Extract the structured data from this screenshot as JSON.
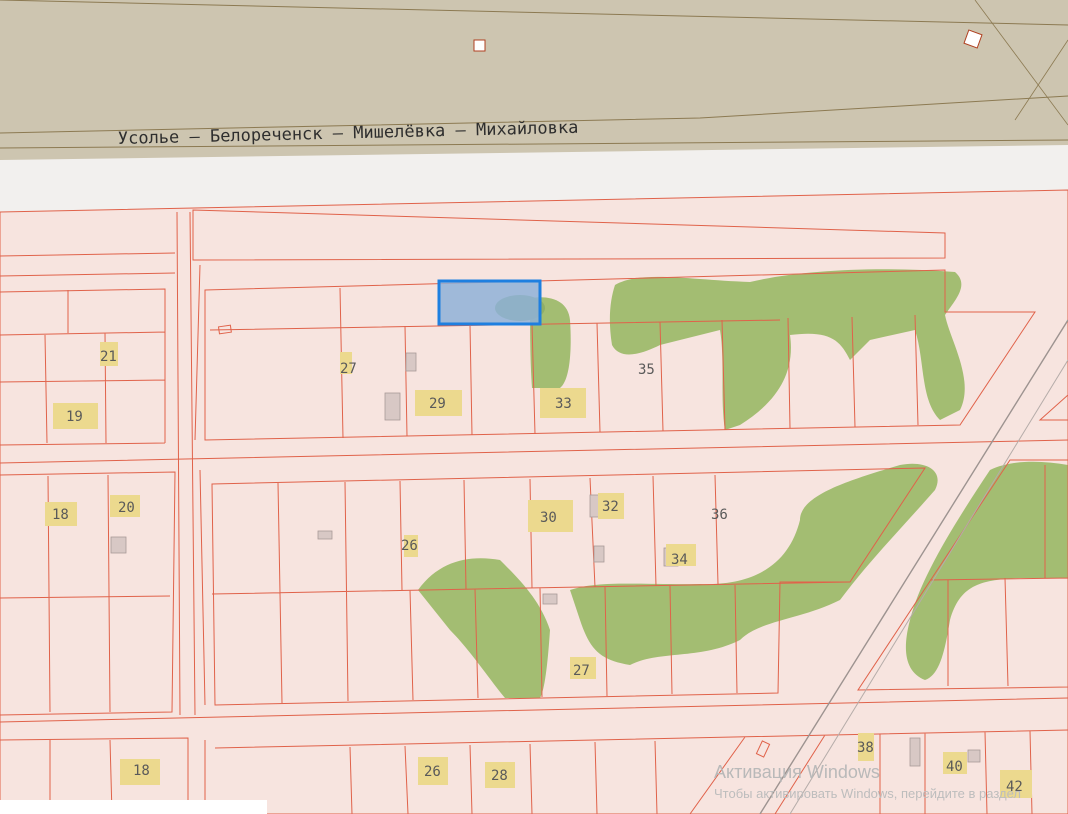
{
  "map": {
    "road_label": "Усолье — Белореченск — Мишелёвка — Михайловка",
    "house_numbers": [
      "21",
      "19",
      "27",
      "29",
      "33",
      "35",
      "18",
      "20",
      "26",
      "30",
      "32",
      "36",
      "34",
      "27",
      "18",
      "26",
      "28",
      "38",
      "40",
      "42"
    ],
    "selected_parcel": "highlighted parcel",
    "colors": {
      "road": "#cdc5b0",
      "parcel_fill": "#f7e4df",
      "parcel_line": "#e0624a",
      "vegetation": "#a3bd72",
      "building": "#ecd98e",
      "selection_fill": "#8fb1d8",
      "selection_stroke": "#1e7fe0"
    }
  },
  "watermark": {
    "title": "Активация Windows",
    "subtitle": "Чтобы активировать Windows, перейдите в раздел"
  }
}
